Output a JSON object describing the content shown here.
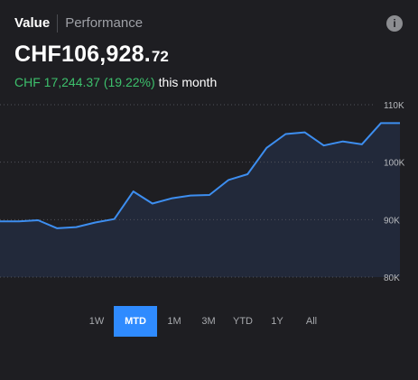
{
  "tabs": [
    {
      "label": "Value",
      "active": true
    },
    {
      "label": "Performance",
      "active": false
    }
  ],
  "info_icon": {
    "name": "info-icon",
    "glyph": "i"
  },
  "balance": {
    "main": "CHF106,928.",
    "cents": "72"
  },
  "change": {
    "delta": "CHF 17,244.37 (19.22%)",
    "period": "this month"
  },
  "colors": {
    "accent": "#2f8bff",
    "positive": "#3dc06c",
    "line": "#3d8ef0",
    "background": "#1e1e22"
  },
  "chart_data": {
    "type": "area",
    "y_ticks": [
      "110K",
      "100K",
      "90K",
      "80K"
    ],
    "ylim": [
      80000,
      110000
    ],
    "grid": true,
    "x": [
      1,
      2,
      3,
      4,
      5,
      6,
      7,
      8,
      9,
      10,
      11,
      12,
      13,
      14,
      15,
      16,
      17,
      18,
      19,
      20,
      21,
      22
    ],
    "values": [
      89700,
      89700,
      89900,
      88500,
      88700,
      89500,
      90100,
      94900,
      92800,
      93700,
      94200,
      94300,
      96900,
      97900,
      102500,
      104900,
      105200,
      102900,
      103600,
      103100,
      106800,
      106800
    ]
  },
  "ranges": [
    {
      "label": "1W",
      "active": false
    },
    {
      "label": "MTD",
      "active": true
    },
    {
      "label": "1M",
      "active": false
    },
    {
      "label": "3M",
      "active": false
    },
    {
      "label": "YTD",
      "active": false
    },
    {
      "label": "1Y",
      "active": false
    },
    {
      "label": "All",
      "active": false
    }
  ]
}
